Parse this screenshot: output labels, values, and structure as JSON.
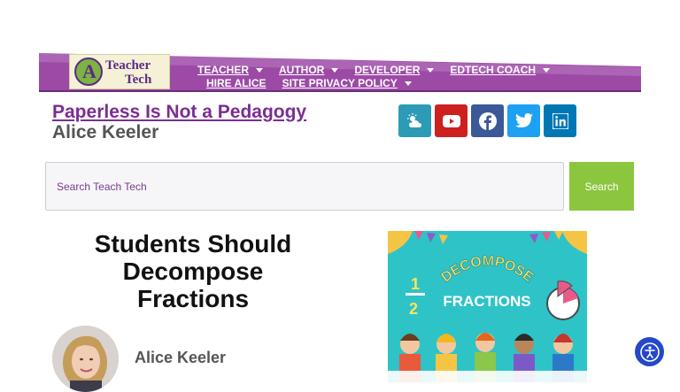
{
  "header": {
    "logo": {
      "line1": "Teacher",
      "line2": "Tech"
    },
    "nav_row1": [
      {
        "label": "TEACHER"
      },
      {
        "label": "AUTHOR"
      },
      {
        "label": "DEVELOPER"
      },
      {
        "label": "EDTECH COACH"
      }
    ],
    "nav_row2": [
      {
        "label": "HIRE ALICE"
      },
      {
        "label": "SITE PRIVACY POLICY"
      }
    ]
  },
  "site": {
    "title": "Paperless Is Not a Pedagogy",
    "author": "Alice Keeler"
  },
  "social": [
    {
      "name": "weather-icon",
      "color": "#2d9bb5"
    },
    {
      "name": "youtube-icon",
      "color": "#cd201f"
    },
    {
      "name": "facebook-icon",
      "color": "#3b5998"
    },
    {
      "name": "twitter-icon",
      "color": "#1da1f2"
    },
    {
      "name": "linkedin-icon",
      "color": "#0077b5"
    }
  ],
  "search": {
    "placeholder": "Search Teach Tech",
    "button_label": "Search"
  },
  "article": {
    "title": "Students Should Decompose Fractions",
    "author": "Alice Keeler"
  },
  "featured_image": {
    "word1": "DECOMPOSE",
    "word2": "FRACTIONS",
    "numerator": "1",
    "denominator": "2"
  },
  "colors": {
    "brand_purple": "#7b2d91",
    "search_green": "#8cc63f",
    "accessibility_blue": "#2448c8"
  }
}
